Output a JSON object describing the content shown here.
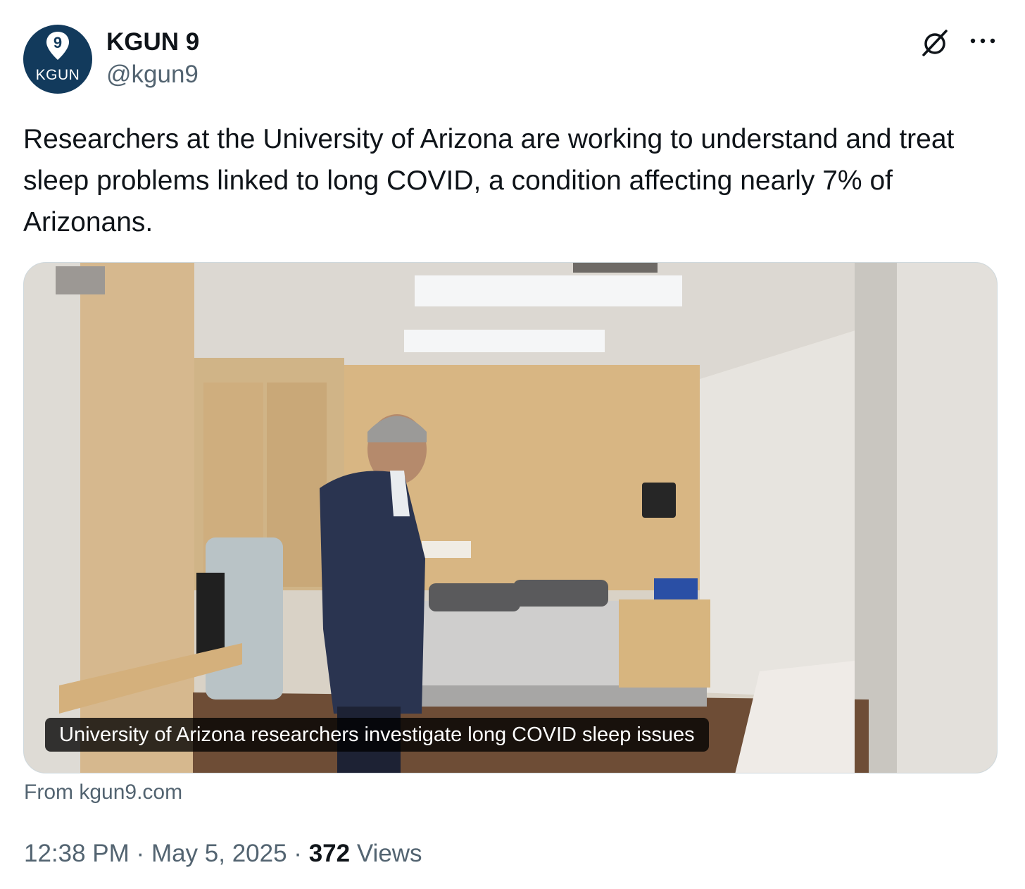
{
  "author": {
    "display_name": "KGUN 9",
    "handle": "@kgun9",
    "avatar_text": "KGUN",
    "avatar_badge": "9"
  },
  "tweet": {
    "text": "Researchers at the University of Arizona are working to understand and treat sleep problems linked to long COVID, a condition affecting nearly 7% of Arizonans."
  },
  "card": {
    "caption": "University of Arizona researchers investigate long COVID sleep issues",
    "source": "From kgun9.com"
  },
  "meta": {
    "time": "12:38 PM",
    "separator": "·",
    "date": "May 5, 2025",
    "views_count": "372",
    "views_label": "Views"
  },
  "icons": {
    "top_right": [
      "grok-icon",
      "more-icon"
    ]
  },
  "colors": {
    "text_primary": "#0f1419",
    "text_secondary": "#536471",
    "avatar_bg": "#123a5c",
    "border": "#cfd9de"
  }
}
